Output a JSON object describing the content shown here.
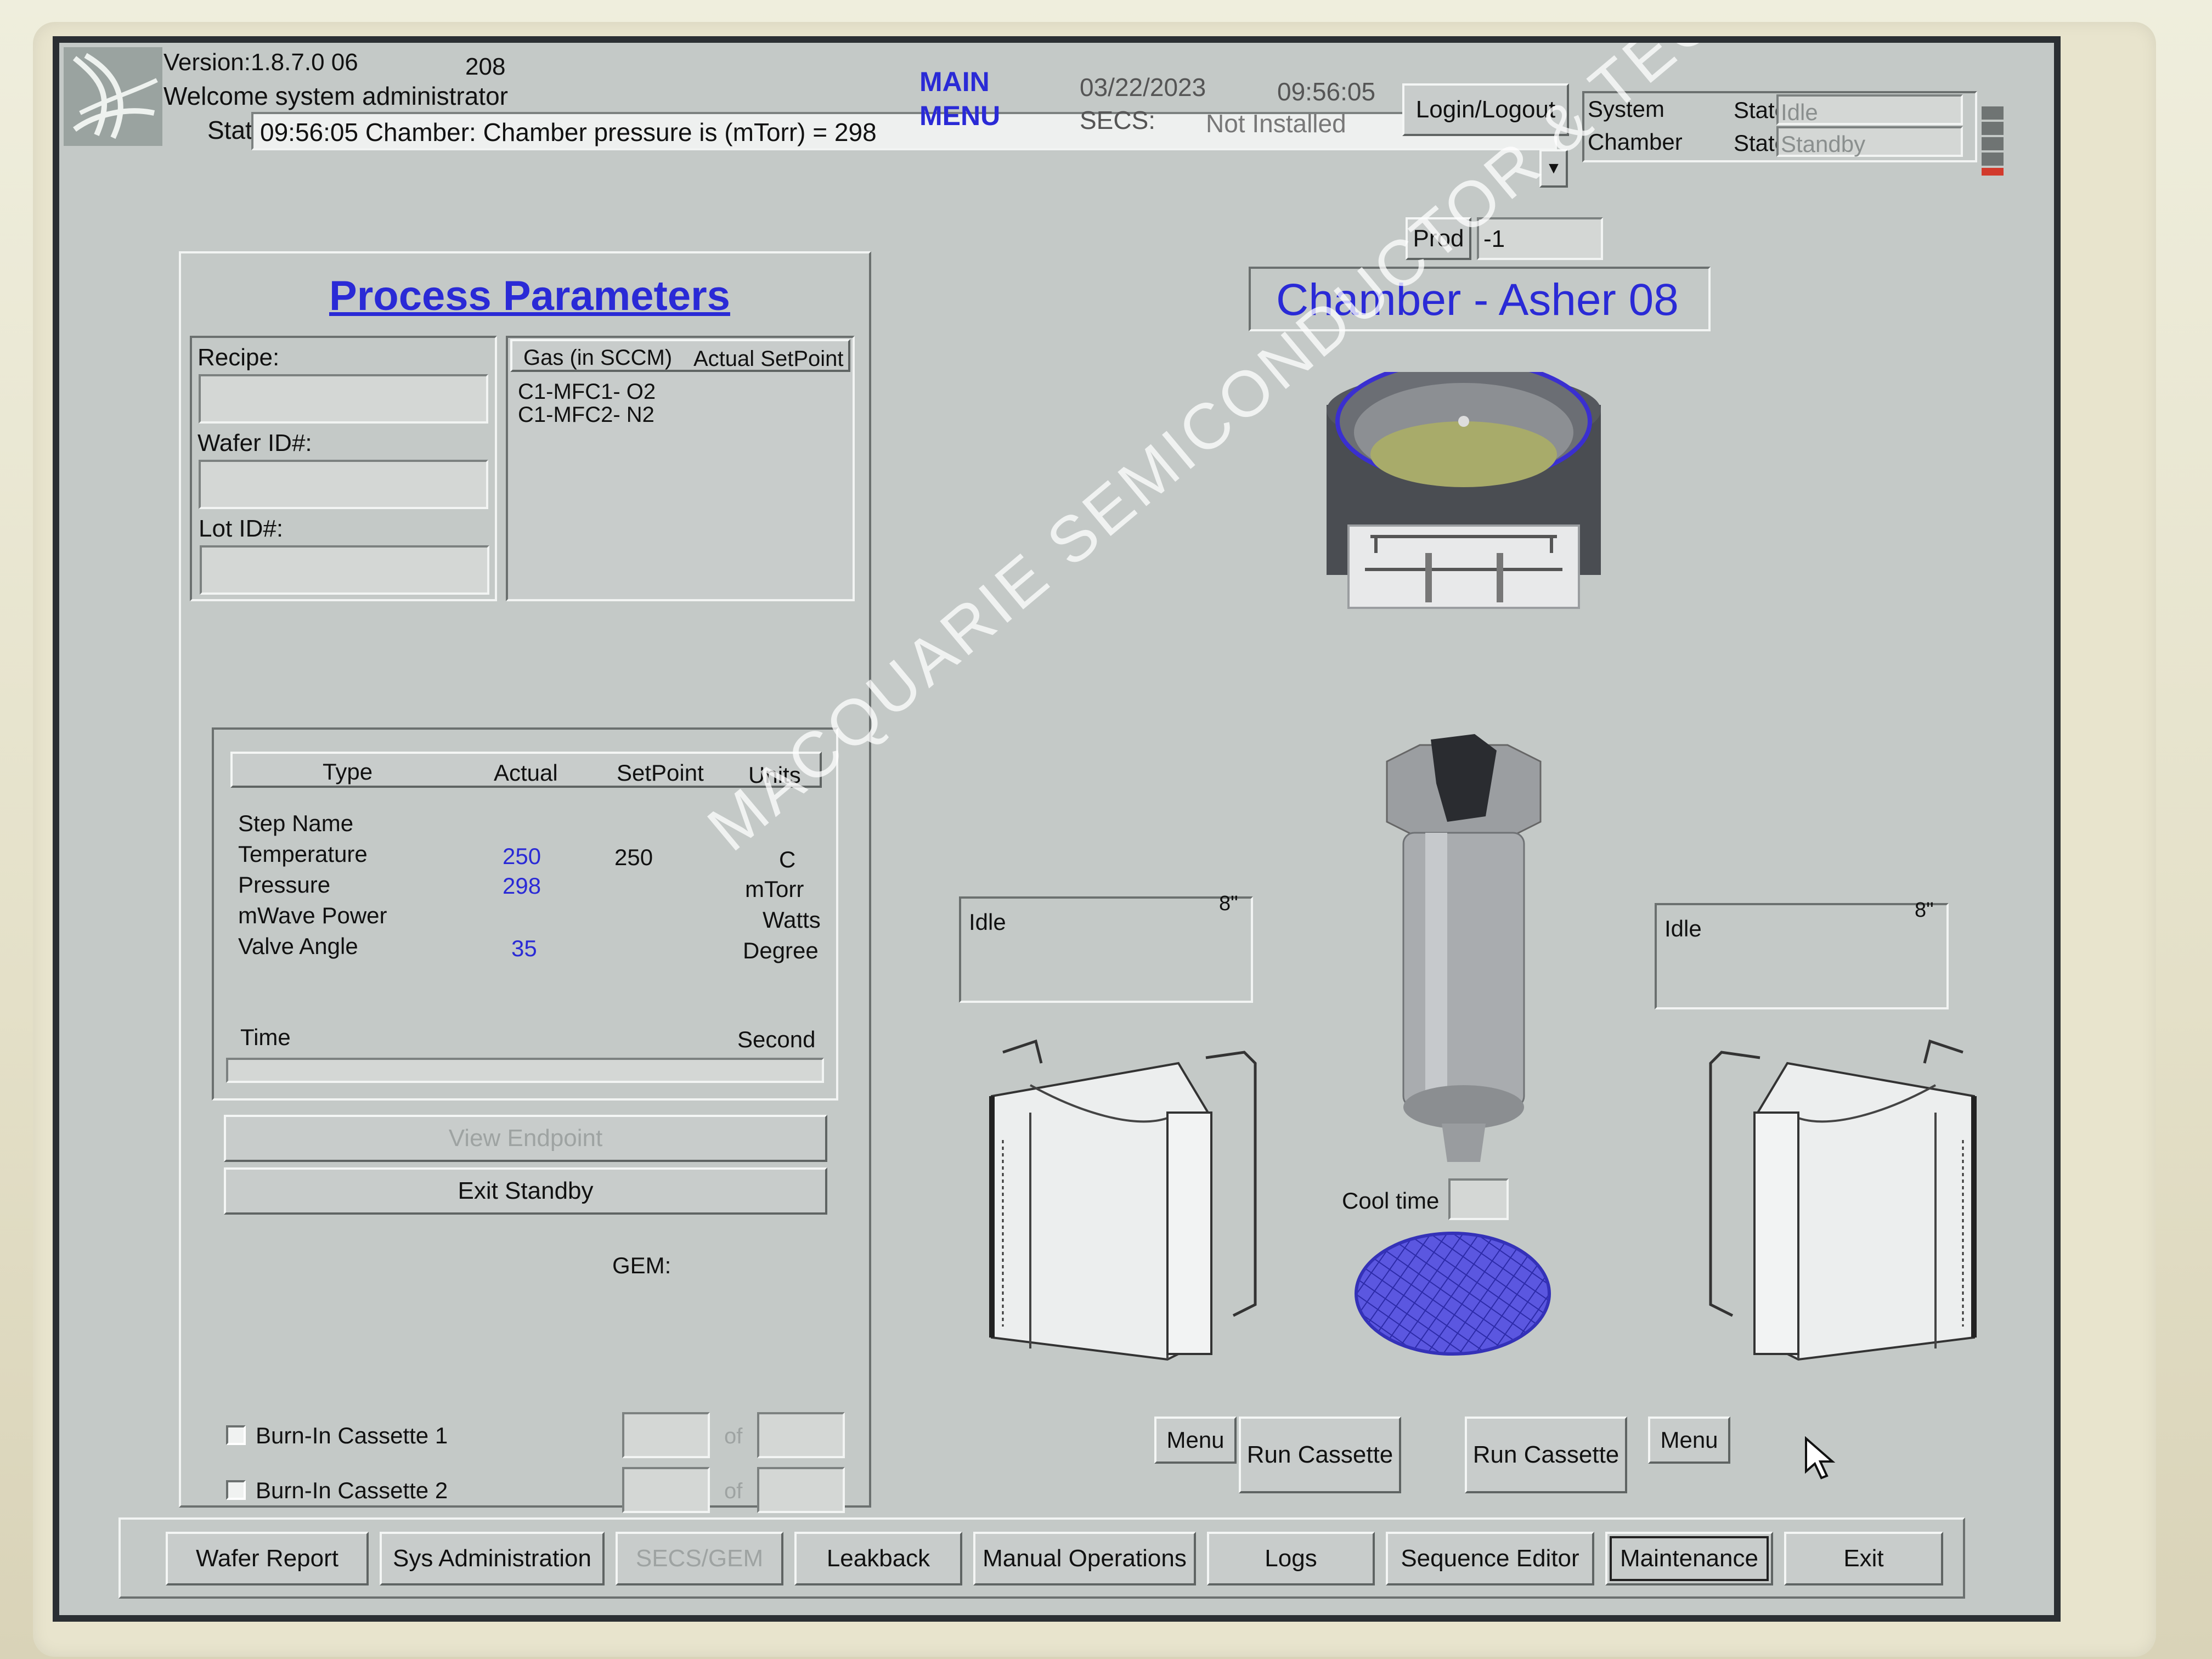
{
  "header": {
    "version": "Version:1.8.7.0 06",
    "version_num": "208",
    "welcome": "Welcome system administrator",
    "status_label": "Status:",
    "status_message": "09:56:05 Chamber: Chamber pressure is (mTorr) = 298",
    "main_menu_line1": "MAIN",
    "main_menu_line2": "MENU",
    "date": "03/22/2023",
    "time": "09:56:05",
    "secs_label": "SECS:",
    "secs_value": "Not Installed",
    "login_button": "Login/Logout",
    "system_label": "System",
    "system_state_label": "State:",
    "system_state": "Idle",
    "chamber_label": "Chamber",
    "chamber_state_label": "State:",
    "chamber_state": "Standby"
  },
  "prod": {
    "label": "Prod",
    "value": "-1"
  },
  "process": {
    "title": "Process Parameters",
    "recipe_label": "Recipe:",
    "wafer_label": "Wafer ID#:",
    "lot_label": "Lot ID#:",
    "gas_header_gas": "Gas  (in SCCM)",
    "gas_header_setpoint": "Actual SetPoint",
    "gases": [
      "C1-MFC1- O2",
      "C1-MFC2- N2"
    ],
    "table_headers": {
      "type": "Type",
      "actual": "Actual",
      "setpoint": "SetPoint",
      "units": "Units"
    },
    "rows": [
      {
        "type": "Step Name",
        "actual": "",
        "setpoint": "",
        "units": ""
      },
      {
        "type": "Temperature",
        "actual": "250",
        "setpoint": "250",
        "units": "C"
      },
      {
        "type": "Pressure",
        "actual": "298",
        "setpoint": "",
        "units": "mTorr"
      },
      {
        "type": "mWave Power",
        "actual": "",
        "setpoint": "",
        "units": "Watts"
      },
      {
        "type": "Valve Angle",
        "actual": "35",
        "setpoint": "",
        "units": "Degree"
      }
    ],
    "time_label": "Time",
    "time_units": "Second",
    "view_endpoint": "View Endpoint",
    "exit_standby": "Exit Standby",
    "gem_label": "GEM:",
    "burn1": "Burn-In Cassette 1",
    "burn2": "Burn-In Cassette 2",
    "of": "of"
  },
  "chamber": {
    "title": "Chamber - Asher 08",
    "left_status": "Idle",
    "left_size": "8\"",
    "right_status": "Idle",
    "right_size": "8\"",
    "cool_time_label": "Cool time",
    "menu_left": "Menu",
    "run_left": "Run Cassette",
    "run_right": "Run Cassette",
    "menu_right": "Menu"
  },
  "bottom_nav": [
    "Wafer Report",
    "Sys Administration",
    "SECS/GEM",
    "Leakback",
    "Manual Operations",
    "Logs",
    "Sequence Editor",
    "Maintenance",
    "Exit"
  ],
  "watermark": "MACQUARIE SEMICONDUCTOR & TECHNOLOGY",
  "colors": {
    "accent_blue": "#2a2ad6",
    "screen_bg": "#c4c9c7"
  }
}
